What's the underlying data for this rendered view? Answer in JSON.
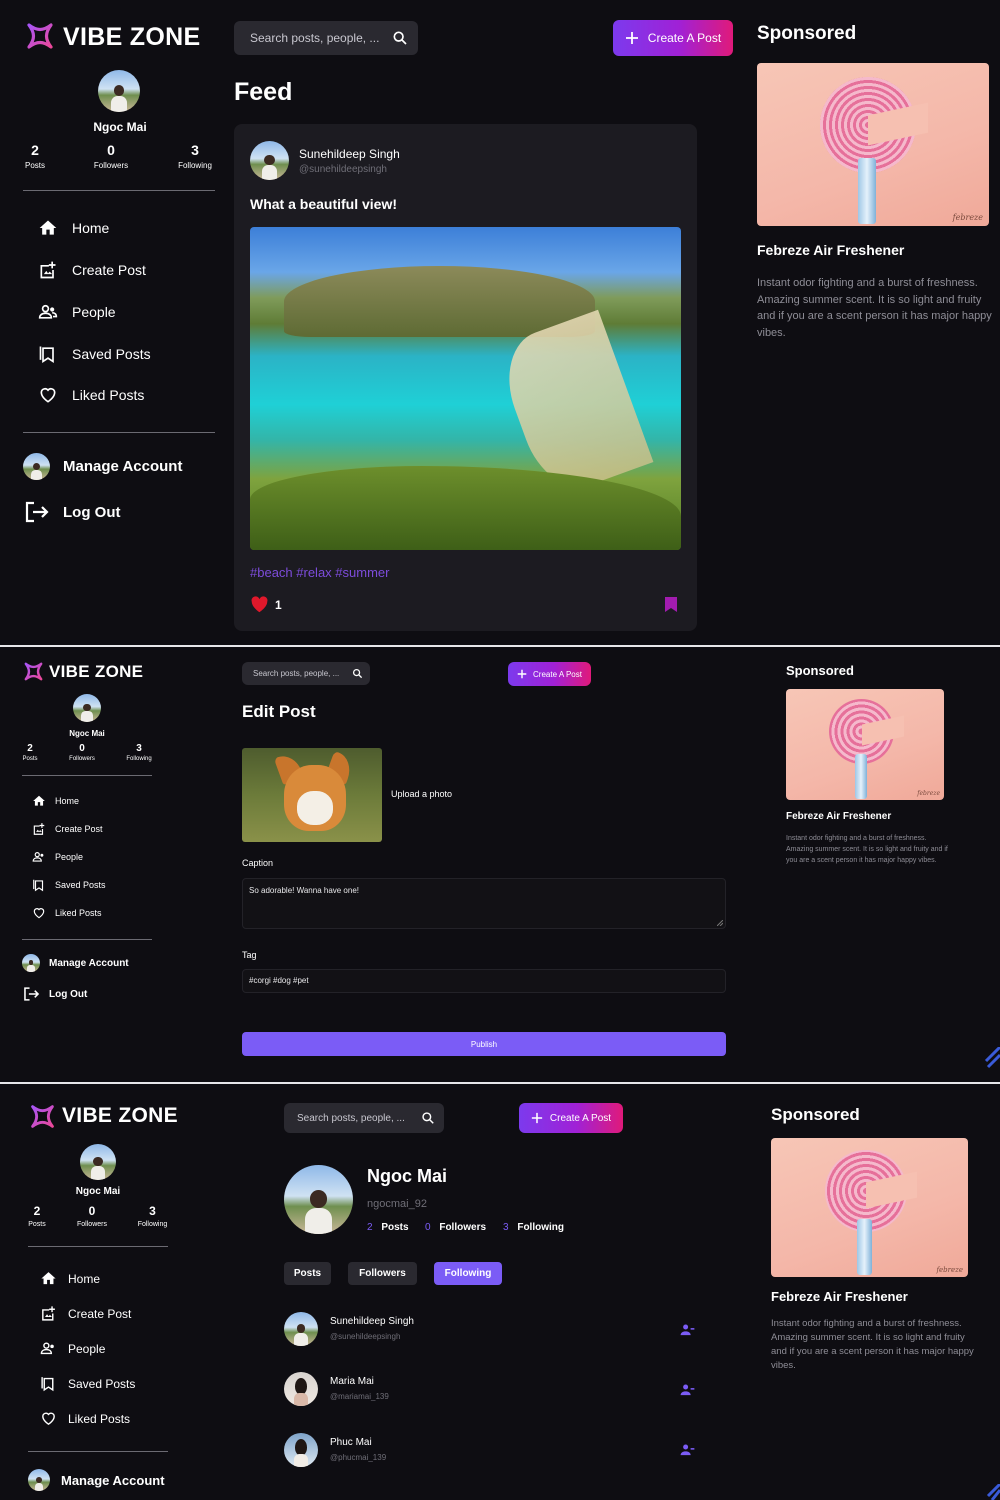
{
  "app": {
    "brand": "VIBE ZONE"
  },
  "user": {
    "name": "Ngoc Mai",
    "handle": "ngocmai_92",
    "stats": [
      {
        "value": "2",
        "label": "Posts"
      },
      {
        "value": "0",
        "label": "Followers"
      },
      {
        "value": "3",
        "label": "Following"
      }
    ]
  },
  "nav": {
    "items": [
      {
        "label": "Home",
        "icon": "home-icon"
      },
      {
        "label": "Create Post",
        "icon": "add-photo-icon"
      },
      {
        "label": "People",
        "icon": "people-icon"
      },
      {
        "label": "Saved Posts",
        "icon": "bookmark-icon"
      },
      {
        "label": "Liked Posts",
        "icon": "heart-icon"
      }
    ],
    "manage_account": "Manage Account",
    "logout": "Log Out"
  },
  "search": {
    "placeholder": "Search posts, people, ..."
  },
  "create_button": {
    "label": "Create A Post"
  },
  "sponsored": {
    "heading": "Sponsored",
    "title": "Febreze Air Freshener",
    "description": "Instant odor fighting and a burst of freshness. Amazing summer scent. It is so light and fruity and if you are a scent person it has major happy vibes.",
    "brand_mark": "febreze"
  },
  "feed": {
    "heading": "Feed",
    "post": {
      "author_name": "Sunehildeep Singh",
      "author_handle": "@sunehildeepsingh",
      "caption": "What a beautiful view!",
      "tags": "#beach #relax #summer",
      "likes": "1"
    }
  },
  "edit_post": {
    "heading": "Edit Post",
    "upload_label": "Upload a photo",
    "caption_label": "Caption",
    "caption_value": "So adorable! Wanna have one!",
    "tag_label": "Tag",
    "tag_value": "#corgi #dog #pet",
    "publish_label": "Publish"
  },
  "profile": {
    "tabs": [
      {
        "label": "Posts",
        "active": false
      },
      {
        "label": "Followers",
        "active": false
      },
      {
        "label": "Following",
        "active": true
      }
    ],
    "following": [
      {
        "name": "Sunehildeep Singh",
        "handle": "@sunehildeepsingh"
      },
      {
        "name": "Maria Mai",
        "handle": "@mariamai_139"
      },
      {
        "name": "Phuc Mai",
        "handle": "@phucmai_139"
      }
    ]
  },
  "colors": {
    "background": "#0e0d12",
    "accent_purple": "#7b5cf6",
    "accent_pink": "#e01a7a",
    "tag_purple": "#7d4cdb",
    "like_red": "#e0182b"
  }
}
